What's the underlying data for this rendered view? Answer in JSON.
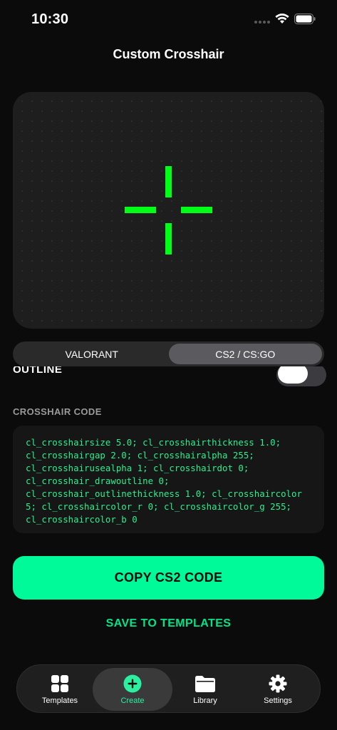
{
  "status_bar": {
    "time": "10:30"
  },
  "header": {
    "title": "Custom Crosshair"
  },
  "preview": {
    "crosshair_color": "#00ff16",
    "background": "#1e1e1e"
  },
  "segmented": {
    "options": [
      {
        "label": "VALORANT",
        "selected": false
      },
      {
        "label": "CS2 / CS:GO",
        "selected": true
      }
    ]
  },
  "outline": {
    "label": "OUTLINE",
    "enabled": false
  },
  "code": {
    "heading": "CROSSHAIR CODE",
    "text": "cl_crosshairsize 5.0; cl_crosshairthickness 1.0; cl_crosshairgap 2.0; cl_crosshairalpha 255; cl_crosshairusealpha 1; cl_crosshairdot 0; cl_crosshair_drawoutline 0; cl_crosshair_outlinethickness 1.0; cl_crosshaircolor 5; cl_crosshaircolor_r 0; cl_crosshaircolor_g 255; cl_crosshaircolor_b 0"
  },
  "actions": {
    "copy_label": "COPY CS2 CODE",
    "save_label": "SAVE TO TEMPLATES"
  },
  "tab_bar": {
    "items": [
      {
        "label": "Templates",
        "icon": "grid-icon",
        "active": false
      },
      {
        "label": "Create",
        "icon": "plus-circle-icon",
        "active": true
      },
      {
        "label": "Library",
        "icon": "folder-icon",
        "active": false
      },
      {
        "label": "Settings",
        "icon": "gear-icon",
        "active": false
      }
    ]
  },
  "colors": {
    "accent": "#00fa9a",
    "code_text": "#2bf08e",
    "crosshair": "#00ff16"
  }
}
